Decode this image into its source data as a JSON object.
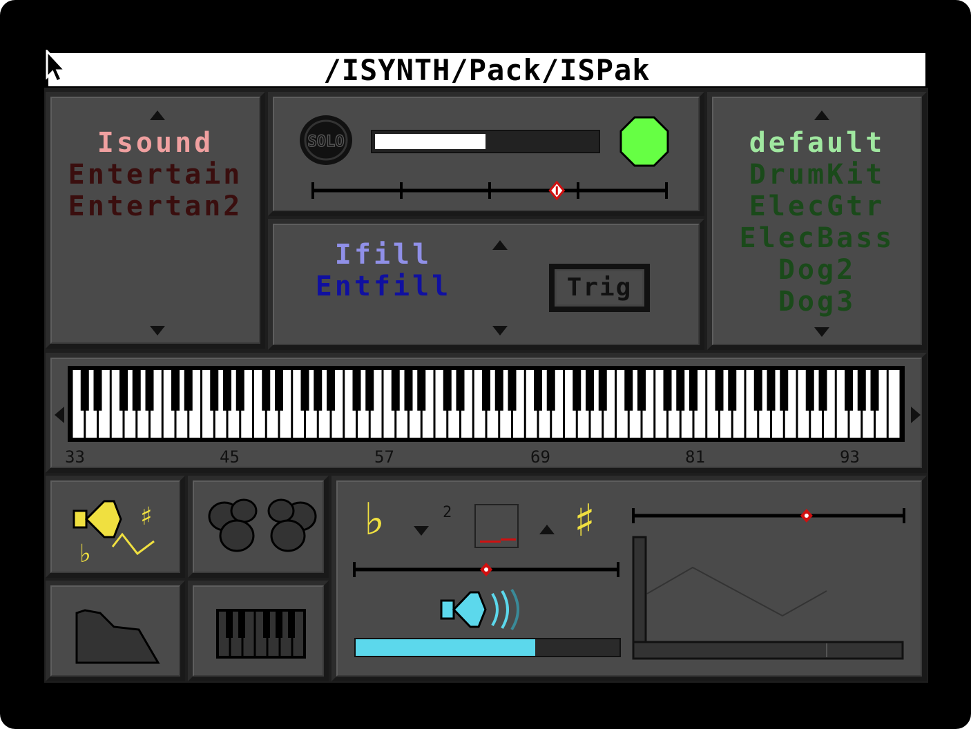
{
  "window": {
    "title": "/ISYNTH/Pack/ISPak"
  },
  "instrument_list": {
    "items": [
      {
        "label": "Isound",
        "color": "#f0a0a0"
      },
      {
        "label": "Entertain",
        "color": "#3a0e0e"
      },
      {
        "label": "Entertan2",
        "color": "#3a0e0e"
      }
    ]
  },
  "fill_list": {
    "items": [
      {
        "label": "Ifill",
        "color": "#9090e8"
      },
      {
        "label": "Entfill",
        "color": "#1010a0"
      }
    ],
    "trig_label": "Trig"
  },
  "solo": {
    "label": "SOLO",
    "volume_fraction": 0.5,
    "position_fraction": 0.69,
    "indicator_color": "#66ff44"
  },
  "pattern_list": {
    "items": [
      {
        "label": "default",
        "color": "#a0e8a0"
      },
      {
        "label": "DrumKit",
        "color": "#1a4a1a"
      },
      {
        "label": "ElecGtr",
        "color": "#1a4a1a"
      },
      {
        "label": "ElecBass",
        "color": "#1a4a1a"
      },
      {
        "label": "Dog2",
        "color": "#1a4a1a"
      },
      {
        "label": "Dog3",
        "color": "#1a4a1a"
      }
    ]
  },
  "keyboard": {
    "note_labels": [
      "33",
      "45",
      "57",
      "69",
      "81",
      "93"
    ]
  },
  "transpose": {
    "value_label": "2",
    "flat_symbol": "♭",
    "sharp_symbol": "♯",
    "slider_fraction": 0.5,
    "volume_fraction": 0.68,
    "accent": "#5cd8ec",
    "symbol_color": "#f0e040"
  },
  "envelope": {
    "slider_fraction": 0.64
  }
}
